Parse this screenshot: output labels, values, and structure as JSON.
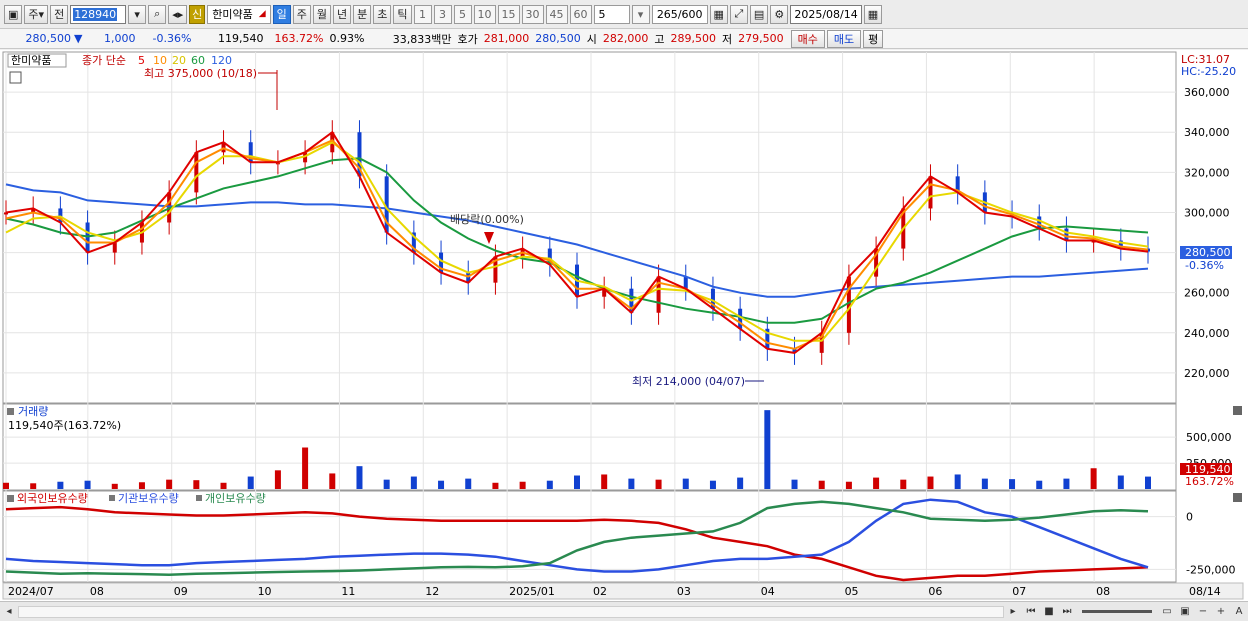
{
  "toolbar": {
    "period_label": "주",
    "prev_label": "전",
    "stock_code": "128940",
    "stock_name": "한미약품",
    "shin_label": "신",
    "tabs": [
      "일",
      "주",
      "월",
      "년",
      "분",
      "초",
      "틱"
    ],
    "active_tab": "일",
    "minute_options": [
      "1",
      "3",
      "5",
      "10",
      "15",
      "30",
      "45",
      "60"
    ],
    "unit_value": "5",
    "count_value": "265",
    "count_total": "/600",
    "date_value": "2025/08/14"
  },
  "infobar": {
    "price": "280,500",
    "change": "1,000",
    "change_pct": "-0.36%",
    "volume": "119,540",
    "volume_pct": "163.72%",
    "turnover_pct": "0.93%",
    "amount": "33,833백만",
    "bid_label": "호가",
    "bid1": "281,000",
    "bid2": "280,500",
    "open_label": "시",
    "open": "282,000",
    "high_label": "고",
    "high": "289,500",
    "low_label": "저",
    "low": "279,500",
    "buy_label": "매수",
    "sell_label": "매도",
    "avg_label": "평"
  },
  "price_panel": {
    "stock_label": "한미약품",
    "ma_prefix": "종가 단순",
    "ma_periods": [
      {
        "label": "5",
        "color": "#e00000"
      },
      {
        "label": "10",
        "color": "#ff8c00"
      },
      {
        "label": "20",
        "color": "#e8d800"
      },
      {
        "label": "60",
        "color": "#1a9a40"
      },
      {
        "label": "120",
        "color": "#2b5fe0"
      }
    ],
    "high_marker": "최고 375,000 (10/18)",
    "low_marker": "최저 214,000 (04/07)",
    "dividend_marker": "배당락(0.00%)",
    "lc_label": "LC:31.07",
    "hc_label": "HC:-25.20",
    "price_tag": "280,500",
    "pct_tag": "-0.36%",
    "y_ticks": [
      "360,000",
      "340,000",
      "320,000",
      "300,000",
      "280,000",
      "260,000",
      "240,000",
      "220,000"
    ]
  },
  "volume_panel": {
    "title": "거래량",
    "value_label": "119,540주(163.72%)",
    "y_ticks": [
      "500,000",
      "250,000"
    ],
    "tag_value": "119,540",
    "tag_pct": "163.72%"
  },
  "holdings_panel": {
    "legend": [
      {
        "label": "외국인보유수량",
        "color": "#d00000"
      },
      {
        "label": "기관보유수량",
        "color": "#2b4fe0"
      },
      {
        "label": "개인보유수량",
        "color": "#2a8a50"
      }
    ],
    "y_ticks": [
      "0",
      "-250,000"
    ]
  },
  "x_axis": {
    "labels": [
      "2024/07",
      "08",
      "09",
      "10",
      "11",
      "12",
      "2025/01",
      "02",
      "03",
      "04",
      "05",
      "06",
      "07",
      "08",
      "08/14"
    ]
  },
  "chart_data": [
    {
      "type": "line",
      "title": "한미약품",
      "ylim": [
        205000,
        380000
      ],
      "ma_series": [
        "5",
        "10",
        "20",
        "60",
        "120"
      ],
      "annotations": [
        "최고 375,000 (10/18)",
        "최저 214,000 (04/07)",
        "배당락(0.00%)"
      ],
      "series": [
        {
          "name": "5",
          "color": "#e00000",
          "values": [
            300000,
            302000,
            295000,
            280000,
            285000,
            295000,
            310000,
            330000,
            335000,
            325000,
            325000,
            330000,
            340000,
            318000,
            290000,
            280000,
            270000,
            265000,
            278000,
            282000,
            274000,
            258000,
            262000,
            250000,
            268000,
            262000,
            252000,
            242000,
            232000,
            230000,
            240000,
            268000,
            282000,
            302000,
            318000,
            310000,
            300000,
            298000,
            292000,
            286000,
            286000,
            282000,
            280500
          ]
        },
        {
          "name": "10",
          "color": "#ff8c00",
          "values": [
            297000,
            300000,
            297000,
            285000,
            285000,
            292000,
            305000,
            325000,
            332000,
            327000,
            325000,
            330000,
            336000,
            322000,
            295000,
            282000,
            272000,
            268000,
            276000,
            280000,
            276000,
            262000,
            262000,
            252000,
            265000,
            262000,
            254000,
            245000,
            235000,
            232000,
            238000,
            262000,
            279000,
            300000,
            314000,
            311000,
            303000,
            299000,
            294000,
            288000,
            287000,
            283000,
            281500
          ]
        },
        {
          "name": "20",
          "color": "#e8d800",
          "values": [
            290000,
            297000,
            298000,
            290000,
            286000,
            290000,
            300000,
            318000,
            328000,
            328000,
            325000,
            328000,
            335000,
            325000,
            302000,
            288000,
            276000,
            270000,
            273000,
            278000,
            277000,
            266000,
            263000,
            256000,
            262000,
            261000,
            256000,
            248000,
            240000,
            236000,
            236000,
            252000,
            272000,
            292000,
            308000,
            310000,
            305000,
            300000,
            296000,
            290000,
            288000,
            285000,
            283000
          ]
        },
        {
          "name": "60",
          "color": "#1a9a40",
          "values": [
            297000,
            294000,
            290000,
            288000,
            290000,
            296000,
            302000,
            307000,
            312000,
            315000,
            318000,
            322000,
            326000,
            327000,
            320000,
            306000,
            295000,
            287000,
            281000,
            277000,
            275000,
            268000,
            262000,
            258000,
            255000,
            252000,
            250000,
            248000,
            245000,
            245000,
            247000,
            255000,
            262000,
            265000,
            270000,
            276000,
            282000,
            288000,
            292000,
            293000,
            292000,
            291000,
            290000
          ]
        },
        {
          "name": "120",
          "color": "#2b5fe0",
          "values": [
            314000,
            311000,
            310000,
            306000,
            305000,
            304000,
            303000,
            303000,
            304000,
            305000,
            305000,
            304000,
            304000,
            303000,
            302000,
            300000,
            298000,
            296000,
            293000,
            290000,
            287000,
            284000,
            280000,
            276000,
            272000,
            268000,
            263000,
            260000,
            258000,
            258000,
            260000,
            262000,
            263000,
            264000,
            265000,
            266000,
            267000,
            268000,
            268000,
            269000,
            270000,
            271000,
            272000
          ]
        }
      ]
    },
    {
      "type": "bar",
      "title": "거래량",
      "ylim": [
        0,
        800000
      ],
      "series": [
        {
          "name": "거래량",
          "values": [
            60000,
            55000,
            70000,
            80000,
            50000,
            65000,
            90000,
            85000,
            60000,
            120000,
            180000,
            400000,
            150000,
            220000,
            90000,
            120000,
            80000,
            100000,
            60000,
            70000,
            80000,
            130000,
            140000,
            100000,
            90000,
            100000,
            80000,
            110000,
            760000,
            90000,
            80000,
            70000,
            110000,
            90000,
            120000,
            140000,
            100000,
            95000,
            80000,
            100000,
            200000,
            130000,
            119540
          ]
        }
      ]
    },
    {
      "type": "line",
      "title": "보유수량",
      "ylim": [
        -300000,
        50000
      ],
      "series": [
        {
          "name": "외국인보유수량",
          "color": "#d00000",
          "values": [
            35000,
            40000,
            45000,
            35000,
            20000,
            15000,
            10000,
            5000,
            5000,
            10000,
            15000,
            20000,
            15000,
            0,
            -10000,
            -15000,
            -20000,
            -20000,
            -20000,
            -20000,
            -20000,
            -20000,
            -15000,
            -20000,
            -30000,
            -60000,
            -100000,
            -120000,
            -140000,
            -180000,
            -200000,
            -240000,
            -280000,
            -300000,
            -290000,
            -280000,
            -280000,
            -270000,
            -260000,
            -255000,
            -250000,
            -245000,
            -240000
          ]
        },
        {
          "name": "기관보유수량",
          "color": "#2b4fe0",
          "values": [
            -200000,
            -210000,
            -215000,
            -220000,
            -225000,
            -230000,
            -230000,
            -220000,
            -215000,
            -210000,
            -205000,
            -200000,
            -190000,
            -185000,
            -180000,
            -175000,
            -175000,
            -180000,
            -190000,
            -210000,
            -230000,
            -250000,
            -260000,
            -260000,
            -250000,
            -230000,
            -210000,
            -200000,
            -200000,
            -190000,
            -180000,
            -120000,
            -20000,
            60000,
            80000,
            70000,
            20000,
            0,
            -50000,
            -100000,
            -150000,
            -200000,
            -240000
          ]
        },
        {
          "name": "개인보유수량",
          "color": "#2a8a50",
          "values": [
            -260000,
            -265000,
            -270000,
            -268000,
            -270000,
            -272000,
            -275000,
            -270000,
            -268000,
            -265000,
            -262000,
            -260000,
            -258000,
            -255000,
            -250000,
            -245000,
            -240000,
            -238000,
            -240000,
            -235000,
            -220000,
            -160000,
            -120000,
            -100000,
            -90000,
            -80000,
            -70000,
            -30000,
            40000,
            60000,
            70000,
            60000,
            40000,
            20000,
            -10000,
            -15000,
            -20000,
            -15000,
            -5000,
            10000,
            25000,
            30000,
            25000
          ]
        }
      ]
    }
  ]
}
